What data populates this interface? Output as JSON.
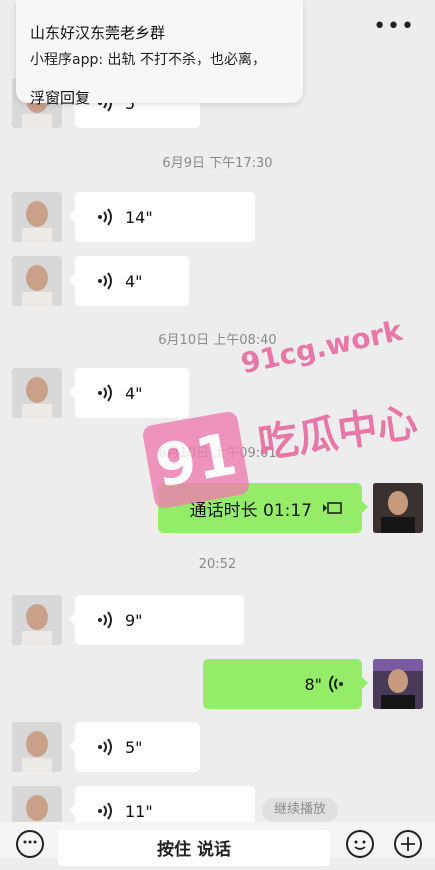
{
  "header": {
    "more_icon": "more-dots-icon"
  },
  "notification": {
    "title": "山东好汉东莞老乡群",
    "body": "小程序app: 出轨 不打不杀，也必离，",
    "reply_label": "浮窗回复"
  },
  "messages": {
    "m0": {
      "duration": "5\""
    },
    "ts1": "6月9日 下午17:30",
    "m1": {
      "duration": "14\""
    },
    "m2": {
      "duration": "4\""
    },
    "ts2": "6月10日 上午08:40",
    "m3": {
      "duration": "4\""
    },
    "ts3": "6月10日 上午09:01",
    "call": {
      "label": "通话时长 01:17",
      "icon": "video-call-icon"
    },
    "ts4": "20:52",
    "m4": {
      "duration": "9\""
    },
    "m5": {
      "duration": "8\""
    },
    "m6": {
      "duration": "5\""
    },
    "m7": {
      "duration": "11\""
    }
  },
  "watermark": {
    "url": "91cg.work",
    "badge": "91",
    "name": "吃瓜中心"
  },
  "continue_playback": "继续播放",
  "input": {
    "hold_to_talk": "按住 说话",
    "voice_icon": "voice-toggle-icon",
    "emoji_icon": "emoji-icon",
    "plus_icon": "plus-icon"
  },
  "colors": {
    "chat_bg": "#ededed",
    "bubble_out": "#95ec69",
    "bubble_in": "#ffffff",
    "watermark": "#e86aa0"
  }
}
